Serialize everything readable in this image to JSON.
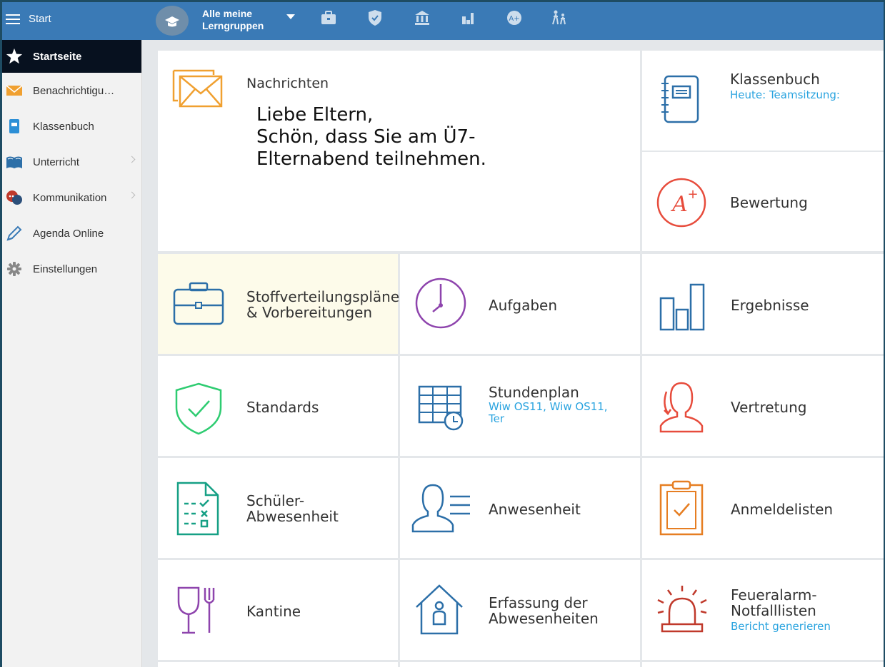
{
  "topbar": {
    "start_label": "Start",
    "group_line1": "Alle meine",
    "group_line2": "Lerngruppen",
    "icons": [
      "briefcase-icon",
      "shield-icon",
      "institution-icon",
      "bar-chart-icon",
      "grade-icon",
      "children-icon"
    ]
  },
  "sidebar": {
    "items": [
      {
        "label": "Startseite",
        "icon": "star-icon"
      },
      {
        "label": "Benachrichtigu…",
        "icon": "envelope-icon"
      },
      {
        "label": "Klassenbuch",
        "icon": "notebook-icon"
      },
      {
        "label": "Unterricht",
        "icon": "book-icon"
      },
      {
        "label": "Kommunikation",
        "icon": "chat-icon"
      },
      {
        "label": "Agenda Online",
        "icon": "pen-icon"
      },
      {
        "label": "Einstellungen",
        "icon": "gear-icon"
      }
    ]
  },
  "tiles": {
    "nachrichten": {
      "title": "Nachrichten",
      "msg": [
        "Liebe Eltern,",
        "Schön, dass Sie am Ü7-",
        "Elternabend teilnehmen."
      ]
    },
    "klassenbuch": {
      "title": "Klassenbuch",
      "sub": "Heute: Teamsitzung:"
    },
    "bewertung": {
      "title": "Bewertung"
    },
    "stoff": {
      "title1": "Stoffverteilungspläne",
      "title2": "& Vorbereitungen"
    },
    "aufgaben": {
      "title": "Aufgaben"
    },
    "ergebnisse": {
      "title": "Ergebnisse"
    },
    "standards": {
      "title": "Standards"
    },
    "stundenplan": {
      "title": "Stundenplan",
      "sub1": "Wiw OS11, Wiw OS11,",
      "sub2": "Ter"
    },
    "vertretung": {
      "title": "Vertretung"
    },
    "schueler": {
      "title1": "Schüler-",
      "title2": "Abwesenheit"
    },
    "anwesenheit": {
      "title": "Anwesenheit"
    },
    "anmeldelisten": {
      "title": "Anmeldelisten"
    },
    "kantine": {
      "title": "Kantine"
    },
    "erfassung": {
      "title1": "Erfassung der",
      "title2": "Abwesenheiten"
    },
    "feueralarm": {
      "title1": "Feueralarm-",
      "title2": "Notfalllisten",
      "sub": "Bericht generieren"
    }
  },
  "colors": {
    "topbar": "#3a7ab6",
    "orange": "#f0a030",
    "blue": "#2c6fa8",
    "purple": "#8e44ad",
    "green": "#2ecc71",
    "red": "#e74c3c",
    "teal": "#16a085",
    "link": "#29a3df"
  }
}
